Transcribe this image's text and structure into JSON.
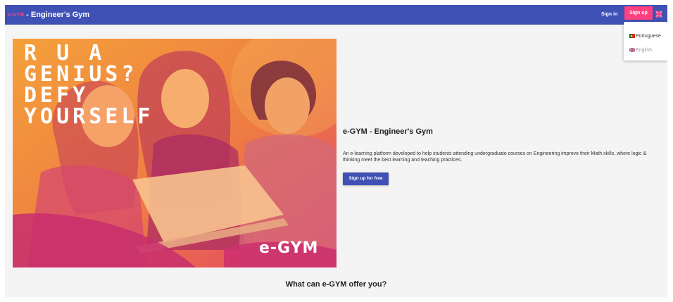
{
  "navbar": {
    "logo_text": "e-GYM",
    "title": "- Engineer's Gym",
    "signin_label": "Sign in",
    "signup_label": "Sign up",
    "language_icon": "uk-flag-icon"
  },
  "language_menu": {
    "items": [
      {
        "label": "Portuguese",
        "flag": "portugal-flag-icon"
      },
      {
        "label": "English",
        "flag": "uk-flag-icon"
      }
    ]
  },
  "hero": {
    "headline": "R U A\nGENIUS?\nDEFY\nYOURSELF",
    "image_logo": "e-GYM",
    "title": "e-GYM - Engineer's Gym",
    "description": "An e-learning platform developed to help students attending undergraduate courses on Engineering improve their Math skills, where logic & thinking meet the best learning and teaching practices.",
    "cta_label": "Sign up for free"
  },
  "section": {
    "title": "What can e-GYM offer you?"
  },
  "colors": {
    "primary": "#3f51b5",
    "accent": "#ff4081",
    "hero_overlay": "#f08a2e"
  }
}
